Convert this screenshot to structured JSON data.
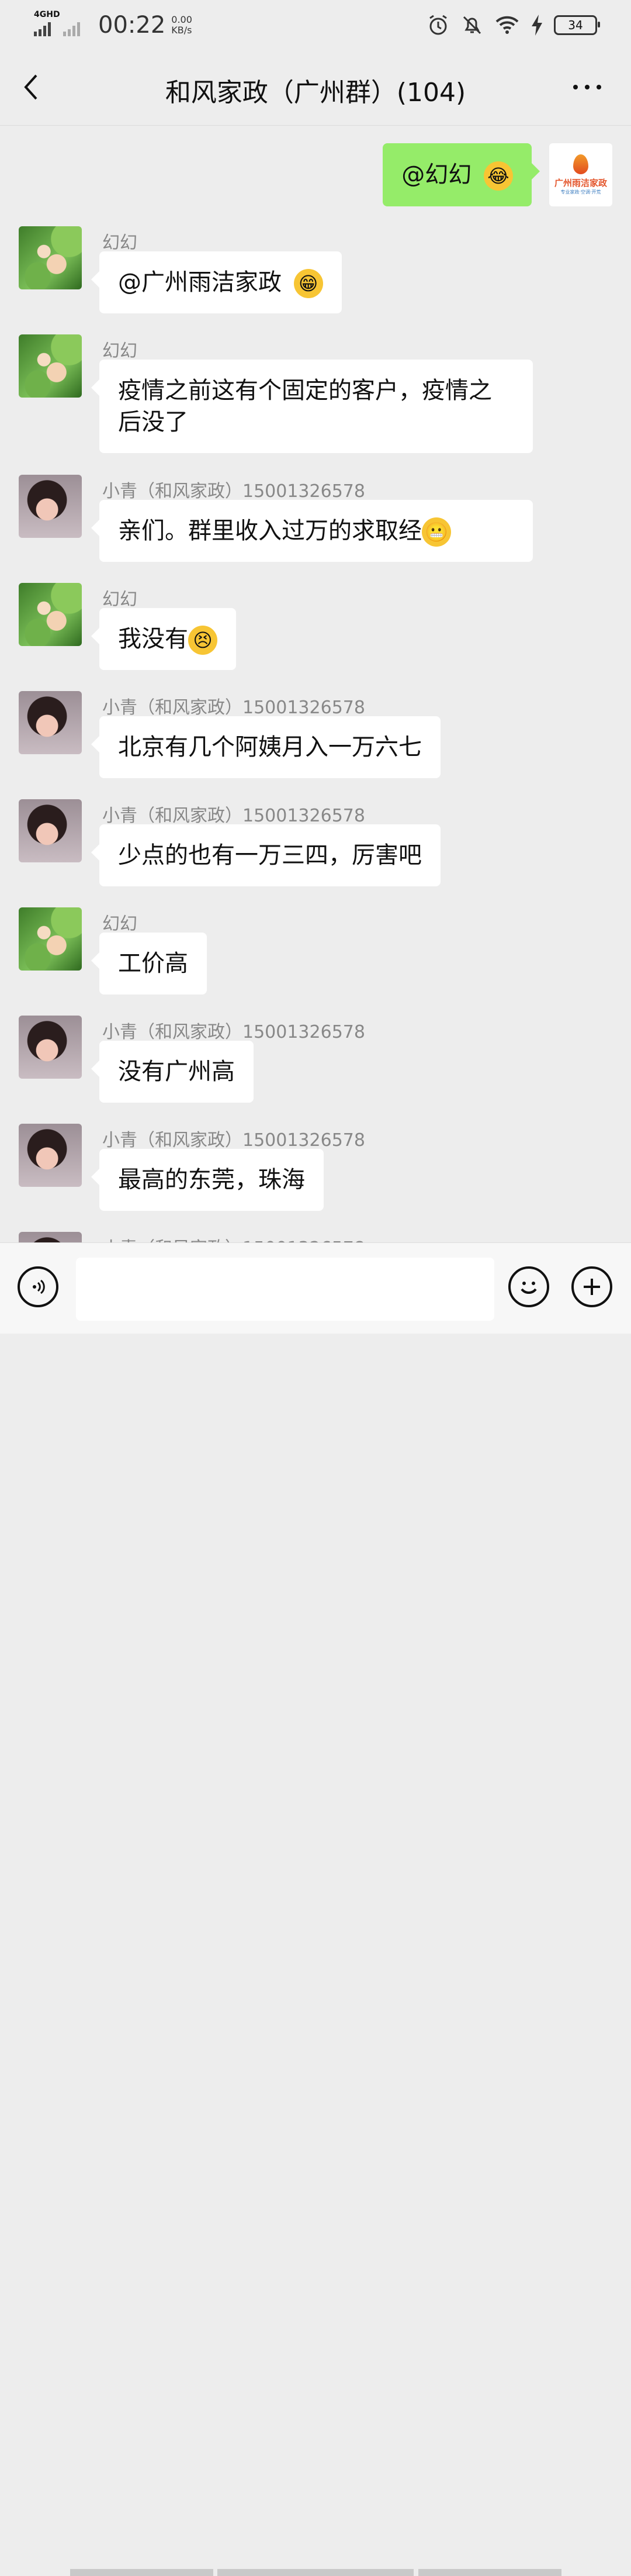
{
  "status_bar": {
    "network": "4GHD",
    "time": "00:22",
    "speed_value": "0.00",
    "speed_unit": "KB/s",
    "battery": "34",
    "icons": [
      "alarm-icon",
      "mute-icon",
      "wifi-icon",
      "charging-icon",
      "battery-icon"
    ]
  },
  "header": {
    "title": "和风家政（广州群）(104)",
    "back_icon": "chevron-left-icon",
    "more_icon": "more-icon"
  },
  "messages": [
    {
      "mine": true,
      "text": "@幻幻",
      "emoji": "😂",
      "avatar_text": "广州雨洁家政",
      "avatar_sub": "专业家政·空调·开荒"
    },
    {
      "sender": "幻幻",
      "text": "@广州雨洁家政",
      "emoji": "😁"
    },
    {
      "sender": "幻幻",
      "text": "疫情之前这有个固定的客户，疫情之后没了"
    },
    {
      "sender": "小青（和风家政）15001326578",
      "text": "亲们。群里收入过万的求取经",
      "emoji": "😬"
    },
    {
      "sender": "幻幻",
      "text": "我没有",
      "emoji": "😣"
    },
    {
      "sender": "小青（和风家政）15001326578",
      "text": "北京有几个阿姨月入一万六七"
    },
    {
      "sender": "小青（和风家政）15001326578",
      "text": "少点的也有一万三四，厉害吧"
    },
    {
      "sender": "幻幻",
      "text": "工价高"
    },
    {
      "sender": "小青（和风家政）15001326578",
      "text": "没有广州高"
    },
    {
      "sender": "小青（和风家政）15001326578",
      "text": "最高的东莞，珠海"
    },
    {
      "sender": "小青（和风家政）15001326578",
      "text": ""
    }
  ],
  "input_bar": {
    "voice_icon": "voice-icon",
    "emoji_icon": "smiley-icon",
    "plus_icon": "plus-icon"
  }
}
